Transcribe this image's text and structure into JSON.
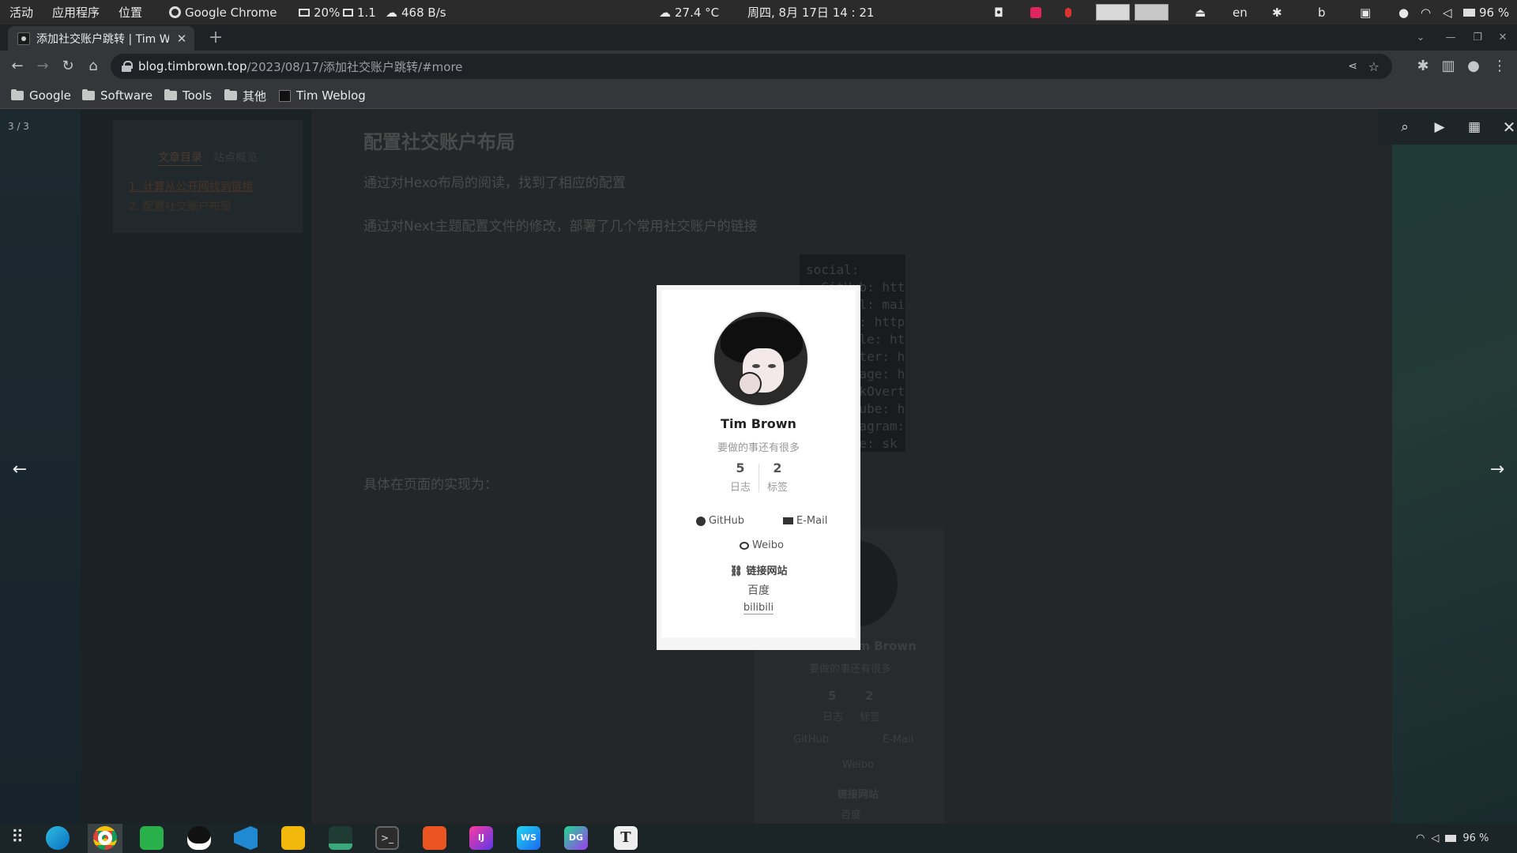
{
  "topbar": {
    "activities": "活动",
    "applications": "应用程序",
    "places": "位置",
    "app_name": "Google Chrome",
    "cpu": "20%",
    "load": "1.1",
    "net": "468 B/s",
    "temperature": "27.4 °C",
    "datetime": "周四, 8月 17日  14 : 21",
    "lang": "en",
    "battery": "96 %"
  },
  "browser": {
    "tab_title": "添加社交账户跳转 | Tim W",
    "url_host": "blog.timbrown.top",
    "url_path": "/2023/08/17/添加社交账户跳转/#more",
    "bookmarks": [
      "Google",
      "Software",
      "Tools",
      "其他",
      "Tim Weblog"
    ]
  },
  "page": {
    "toc_tabs": [
      "文章目录",
      "站点概览"
    ],
    "toc_items": [
      "1. 计算从公开网找到链接",
      "2. 配置社交账户布局"
    ],
    "heading": "配置社交账户布局",
    "paragraphs": [
      "通过对Hexo布局的阅读，找到了相应的配置",
      "通过对Next主题配置文件的修改，部署了几个常用社交账户的链接",
      "具体在页面的实现为："
    ],
    "code_lines": [
      "social:",
      "  GitHub: htt",
      "  E-Mail: mai",
      "  Weibo: http",
      "  #Google: ht",
      "  #Twitter: h",
      "  #FB Page: h",
      "  #StackOvert",
      "  #YouTube: h",
      "  #Instagram:",
      "  #Skype: sk"
    ],
    "ghost": {
      "name": "Tim Brown",
      "desc": "要做的事还有很多",
      "posts": "5",
      "tags": "2",
      "posts_label": "日志",
      "tags_label": "标签",
      "github": "GitHub",
      "email": "E-Mail",
      "weibo": "Weibo",
      "links_title": "链接网站",
      "baidu": "百度"
    }
  },
  "lightbox": {
    "counter": "3 / 3",
    "card": {
      "name": "Tim Brown",
      "desc": "要做的事还有很多",
      "posts_count": "5",
      "posts_label": "日志",
      "tags_count": "2",
      "tags_label": "标签",
      "github": "GitHub",
      "email": "E-Mail",
      "weibo": "Weibo",
      "links_title": "链接网站",
      "link1": "百度",
      "link2": "bilibili"
    }
  },
  "dock": {
    "battery": "96 %",
    "apps": [
      "apps-grid",
      "edge",
      "chrome",
      "wechat",
      "qq",
      "vscode",
      "files",
      "system-monitor",
      "terminal",
      "ubuntu-software",
      "intellij",
      "webstorm",
      "datagrip",
      "typora"
    ]
  }
}
